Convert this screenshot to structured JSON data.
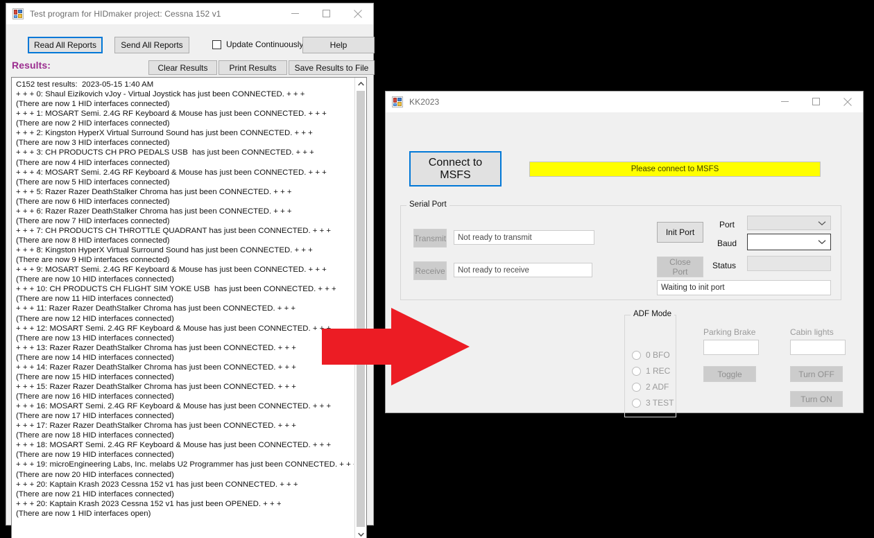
{
  "windows": {
    "hidmaker": {
      "title": "Test program for HIDmaker project: Cessna 152 v1",
      "icon": "winforms-app-icon",
      "titlebar_buttons": {
        "minimize": "minimize-icon",
        "maximize": "maximize-icon",
        "close": "close-icon"
      },
      "toolbar": {
        "read_all_reports": "Read All Reports",
        "send_all_reports": "Send All Reports",
        "update_continuously": "Update Continuously",
        "update_continuously_checked": false,
        "help": "Help",
        "clear_results": "Clear Results",
        "print_results": "Print Results",
        "save_results_to_file": "Save Results to File"
      },
      "results_label": "Results:",
      "results_label_color": "#9b2d8f",
      "results_text": "C152 test results:  2023-05-15 1:40 AM\n+ + + 0: Shaul Eizikovich vJoy - Virtual Joystick has just been CONNECTED. + + +\n(There are now 1 HID interfaces connected)\n+ + + 1: MOSART Semi. 2.4G RF Keyboard & Mouse has just been CONNECTED. + + +\n(There are now 2 HID interfaces connected)\n+ + + 2: Kingston HyperX Virtual Surround Sound has just been CONNECTED. + + +\n(There are now 3 HID interfaces connected)\n+ + + 3: CH PRODUCTS CH PRO PEDALS USB  has just been CONNECTED. + + +\n(There are now 4 HID interfaces connected)\n+ + + 4: MOSART Semi. 2.4G RF Keyboard & Mouse has just been CONNECTED. + + +\n(There are now 5 HID interfaces connected)\n+ + + 5: Razer Razer DeathStalker Chroma has just been CONNECTED. + + +\n(There are now 6 HID interfaces connected)\n+ + + 6: Razer Razer DeathStalker Chroma has just been CONNECTED. + + +\n(There are now 7 HID interfaces connected)\n+ + + 7: CH PRODUCTS CH THROTTLE QUADRANT has just been CONNECTED. + + +\n(There are now 8 HID interfaces connected)\n+ + + 8: Kingston HyperX Virtual Surround Sound has just been CONNECTED. + + +\n(There are now 9 HID interfaces connected)\n+ + + 9: MOSART Semi. 2.4G RF Keyboard & Mouse has just been CONNECTED. + + +\n(There are now 10 HID interfaces connected)\n+ + + 10: CH PRODUCTS CH FLIGHT SIM YOKE USB  has just been CONNECTED. + + +\n(There are now 11 HID interfaces connected)\n+ + + 11: Razer Razer DeathStalker Chroma has just been CONNECTED. + + +\n(There are now 12 HID interfaces connected)\n+ + + 12: MOSART Semi. 2.4G RF Keyboard & Mouse has just been CONNECTED. + + +\n(There are now 13 HID interfaces connected)\n+ + + 13: Razer Razer DeathStalker Chroma has just been CONNECTED. + + +\n(There are now 14 HID interfaces connected)\n+ + + 14: Razer Razer DeathStalker Chroma has just been CONNECTED. + + +\n(There are now 15 HID interfaces connected)\n+ + + 15: Razer Razer DeathStalker Chroma has just been CONNECTED. + + +\n(There are now 16 HID interfaces connected)\n+ + + 16: MOSART Semi. 2.4G RF Keyboard & Mouse has just been CONNECTED. + + +\n(There are now 17 HID interfaces connected)\n+ + + 17: Razer Razer DeathStalker Chroma has just been CONNECTED. + + +\n(There are now 18 HID interfaces connected)\n+ + + 18: MOSART Semi. 2.4G RF Keyboard & Mouse has just been CONNECTED. + + +\n(There are now 19 HID interfaces connected)\n+ + + 19: microEngineering Labs, Inc. melabs U2 Programmer has just been CONNECTED. + + +\n(There are now 20 HID interfaces connected)\n+ + + 20: Kaptain Krash 2023 Cessna 152 v1 has just been CONNECTED. + + +\n(There are now 21 HID interfaces connected)\n+ + + 20: Kaptain Krash 2023 Cessna 152 v1 has just been OPENED. + + +\n(There are now 1 HID interfaces open)"
    },
    "kk2023": {
      "title": "KK2023",
      "icon": "winforms-app-icon",
      "connect_button": "Connect to MSFS",
      "msfs_status": "Please connect to MSFS",
      "msfs_status_bg": "#ffff00",
      "serial_port": {
        "group_title": "Serial Port",
        "transmit_button": "Transmit",
        "transmit_value": "Not ready to transmit",
        "receive_button": "Receive",
        "receive_value": "Not ready to receive",
        "init_port_button": "Init Port",
        "close_port_button": "Close Port",
        "port_label": "Port",
        "port_value": "",
        "baud_label": "Baud",
        "baud_value": "",
        "status_label": "Status",
        "status_value": "",
        "waiting_value": "Waiting to init port"
      },
      "adf_mode": {
        "group_title": "ADF Mode",
        "options": [
          "0 BFO",
          "1 REC",
          "2 ADF",
          "3 TEST"
        ],
        "selected": null
      },
      "parking_brake": {
        "label": "Parking Brake",
        "value": "",
        "toggle_button": "Toggle"
      },
      "cabin_lights": {
        "label": "Cabin lights",
        "value": "",
        "turn_off_button": "Turn OFF",
        "turn_on_button": "Turn ON"
      }
    }
  },
  "annotation": {
    "arrow": "red-right-arrow",
    "arrow_color": "#ec1c24"
  },
  "desktop": {
    "background_color": "#000000"
  }
}
